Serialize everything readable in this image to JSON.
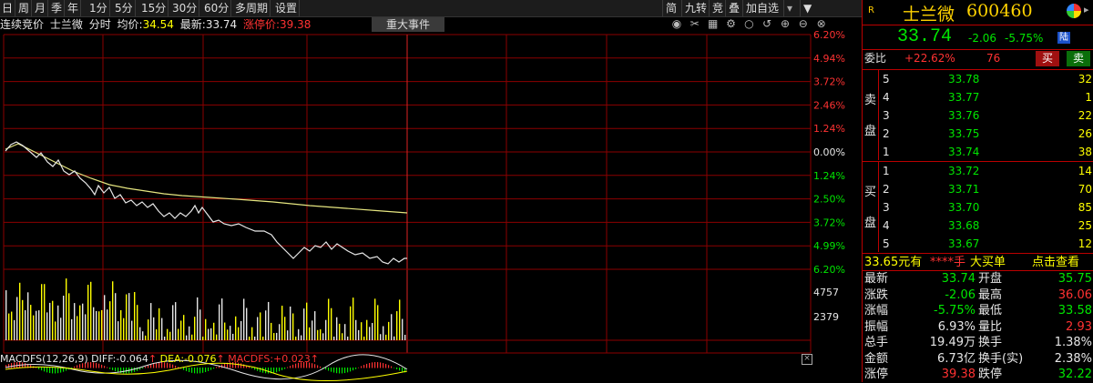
{
  "toolbar": {
    "periods": [
      "日",
      "周",
      "月",
      "季",
      "年",
      "1分",
      "5分",
      "15分",
      "30分",
      "60分",
      "多周期",
      "设置"
    ],
    "right": [
      "简",
      "九转",
      "竞",
      "叠",
      "加自选"
    ],
    "dropdown": "▼"
  },
  "info": {
    "mode": "连续竞价",
    "stock": "士兰微",
    "view": "分时",
    "avg_label": "均价:",
    "avg_value": "34.54",
    "latest_label": "最新:",
    "latest_value": "33.74",
    "limit_label": "涨停价:",
    "limit_value": "39.38"
  },
  "event_button": "重大事件",
  "pct_axis": [
    "6.20%",
    "4.94%",
    "3.72%",
    "2.46%",
    "1.24%",
    "0.00%",
    "1.24%",
    "2.50%",
    "3.72%",
    "4.99%",
    "6.20%"
  ],
  "vol_axis": [
    "4757",
    "2379"
  ],
  "macd": {
    "title": "MACDFS(12,26,9)",
    "diff_label": "DIFF:",
    "diff_value": "-0.064",
    "dea_label": "DEA:",
    "dea_value": "-0.076",
    "macd_label": "MACDFS:",
    "macd_value": "+0.023"
  },
  "panel": {
    "badge": "R",
    "name": "士兰微",
    "code": "600460",
    "price": "33.74",
    "change": "-2.06",
    "change_pct": "-5.75%",
    "tag": "陆",
    "ratio_label": "委比",
    "ratio_value": "+22.62%",
    "ratio_diff": "76",
    "buy_btn": "买",
    "sell_btn": "卖",
    "sell_label": [
      "卖",
      "盘"
    ],
    "buy_label": [
      "买",
      "盘"
    ],
    "asks": [
      {
        "lvl": "5",
        "price": "33.78",
        "vol": "32"
      },
      {
        "lvl": "4",
        "price": "33.77",
        "vol": "1"
      },
      {
        "lvl": "3",
        "price": "33.76",
        "vol": "22"
      },
      {
        "lvl": "2",
        "price": "33.75",
        "vol": "26"
      },
      {
        "lvl": "1",
        "price": "33.74",
        "vol": "38"
      }
    ],
    "bids": [
      {
        "lvl": "1",
        "price": "33.72",
        "vol": "14"
      },
      {
        "lvl": "2",
        "price": "33.71",
        "vol": "70"
      },
      {
        "lvl": "3",
        "price": "33.70",
        "vol": "85"
      },
      {
        "lvl": "4",
        "price": "33.68",
        "vol": "25"
      },
      {
        "lvl": "5",
        "price": "33.67",
        "vol": "12"
      }
    ],
    "big_order_price": "33.65元有",
    "big_order_stars": "****手",
    "big_order_label": "大买单",
    "big_order_link": "点击查看",
    "stats": [
      {
        "l1": "最新",
        "v1": "33.74",
        "c1": "green",
        "l2": "开盘",
        "v2": "35.75",
        "c2": "green"
      },
      {
        "l1": "涨跌",
        "v1": "-2.06",
        "c1": "green",
        "l2": "最高",
        "v2": "36.06",
        "c2": "red"
      },
      {
        "l1": "涨幅",
        "v1": "-5.75%",
        "c1": "green",
        "l2": "最低",
        "v2": "33.58",
        "c2": "green"
      },
      {
        "l1": "振幅",
        "v1": "6.93%",
        "c1": "white",
        "l2": "量比",
        "v2": "2.93",
        "c2": "red"
      },
      {
        "l1": "总手",
        "v1": "19.49万",
        "c1": "white",
        "l2": "换手",
        "v2": "1.38%",
        "c2": "white"
      },
      {
        "l1": "金额",
        "v1": "6.73亿",
        "c1": "white",
        "l2": "换手(实)",
        "v2": "2.38%",
        "c2": "white"
      },
      {
        "l1": "涨停",
        "v1": "39.38",
        "c1": "red",
        "l2": "跌停",
        "v2": "32.22",
        "c2": "green"
      }
    ]
  },
  "colors": {
    "price_line": "#e8e8e8",
    "avg_line": "#e6e680",
    "grid": "#8b0000",
    "up": "#ff3232",
    "down": "#00e600"
  }
}
